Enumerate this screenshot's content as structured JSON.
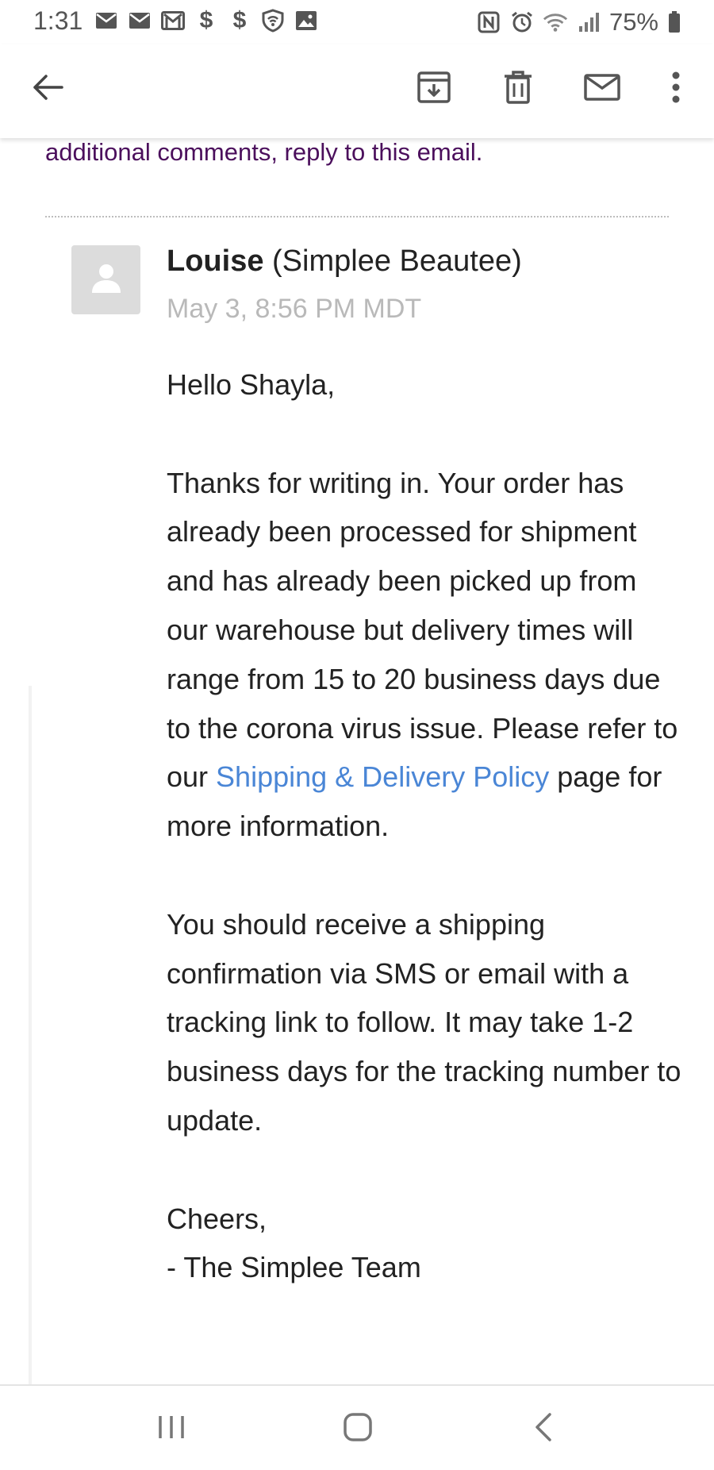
{
  "status_bar": {
    "time": "1:31",
    "battery_percent": "75%",
    "left_icons": [
      "mail-icon",
      "mail-icon",
      "gmail-icon",
      "dollar-icon",
      "dollar-icon",
      "shield-wifi-icon",
      "image-icon"
    ],
    "right_icons": [
      "nfc-icon",
      "alarm-icon",
      "wifi-icon",
      "signal-icon",
      "battery-icon"
    ],
    "dollar_glyph": "$"
  },
  "app_bar": {
    "icons": [
      "back-arrow-icon",
      "archive-icon",
      "delete-icon",
      "mail-icon",
      "more-vert-icon"
    ]
  },
  "previous_message": {
    "tail_text": "additional comments, reply to this email."
  },
  "message": {
    "sender_name": "Louise",
    "sender_org": "(Simplee Beautee)",
    "date": "May 3, 8:56 PM MDT",
    "greeting": "Hello Shayla,",
    "paragraph1_before_link": "Thanks for writing in. Your order has already been processed for shipment and has already been picked up from our warehouse but delivery times will range from 15 to 20 business days due to the corona virus issue. Please refer to our ",
    "link_text": "Shipping & Delivery Policy",
    "paragraph1_after_link": " page for more information.",
    "paragraph2": "You should receive a shipping confirmation via SMS or email with a tracking link to follow. It may take 1-2 business days for the tracking number to update.",
    "signoff": "Cheers,",
    "signature": "- The Simplee Team"
  },
  "nav_bar": {
    "icons": [
      "recents-icon",
      "home-icon",
      "back-icon"
    ]
  },
  "colors": {
    "link": "#4a86d6",
    "visited_link": "#4b0f5c",
    "date_gray": "#b9b9b9",
    "avatar_bg": "#dcdcdc"
  }
}
